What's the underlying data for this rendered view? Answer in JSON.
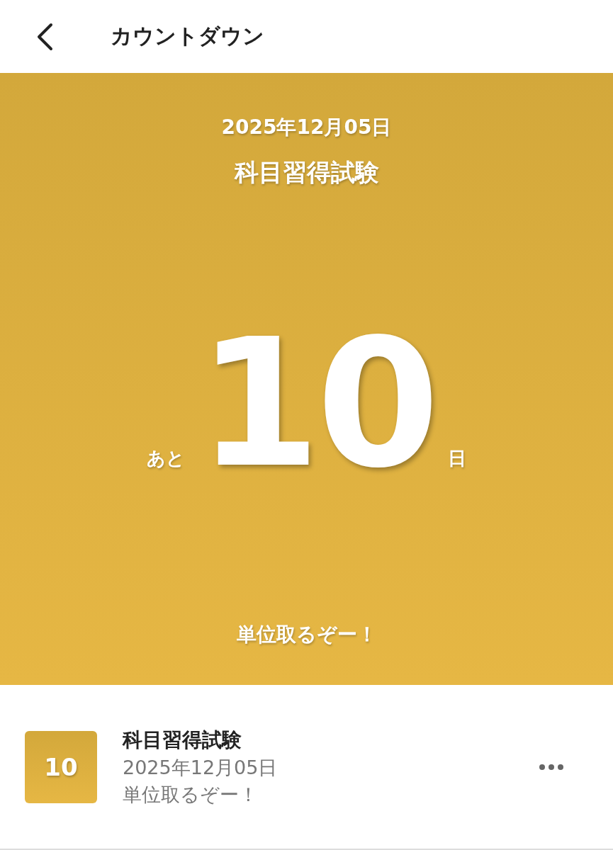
{
  "header": {
    "title": "カウントダウン"
  },
  "countdown": {
    "date": "2025年12月05日",
    "title": "科目習得試験",
    "prefix": "あと",
    "days": "10",
    "suffix": "日",
    "message": "単位取るぞー！"
  },
  "list": [
    {
      "days": "10",
      "title": "科目習得試験",
      "date": "2025年12月05日",
      "message": "単位取るぞー！"
    }
  ]
}
